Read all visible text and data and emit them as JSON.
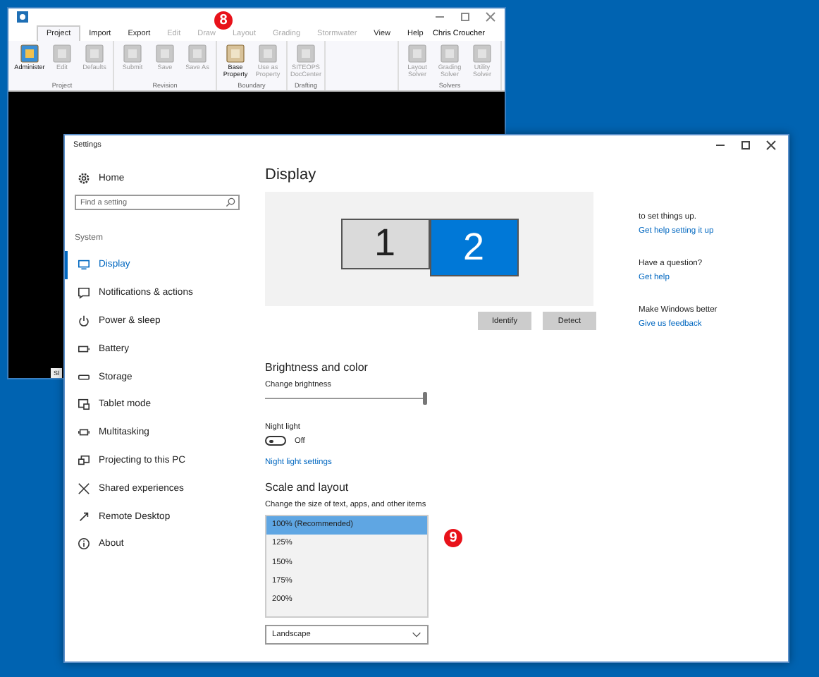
{
  "back_window": {
    "tabs": [
      {
        "label": "Project",
        "selected": true,
        "disabled": false
      },
      {
        "label": "Import",
        "selected": false,
        "disabled": false
      },
      {
        "label": "Export",
        "selected": false,
        "disabled": false
      },
      {
        "label": "Edit",
        "selected": false,
        "disabled": true
      },
      {
        "label": "Draw",
        "selected": false,
        "disabled": true
      },
      {
        "label": "Layout",
        "selected": false,
        "disabled": true
      },
      {
        "label": "Grading",
        "selected": false,
        "disabled": true
      },
      {
        "label": "Stormwater",
        "selected": false,
        "disabled": true
      },
      {
        "label": "View",
        "selected": false,
        "disabled": false
      },
      {
        "label": "Help",
        "selected": false,
        "disabled": false
      }
    ],
    "user": "Chris Croucher",
    "ribbon_groups": [
      {
        "label": "Project",
        "buttons": [
          {
            "label": "Administer",
            "disabled": false
          },
          {
            "label": "Edit",
            "disabled": true
          },
          {
            "label": "Defaults",
            "disabled": true
          }
        ]
      },
      {
        "label": "Revision",
        "buttons": [
          {
            "label": "Submit",
            "disabled": true
          },
          {
            "label": "Save",
            "disabled": true
          },
          {
            "label": "Save As",
            "disabled": true
          }
        ]
      },
      {
        "label": "Boundary",
        "buttons": [
          {
            "label": "Base Property",
            "disabled": false
          },
          {
            "label": "Use as Property",
            "disabled": true
          }
        ]
      },
      {
        "label": "Drafting",
        "buttons": [
          {
            "label": "SITEOPS DocCenter",
            "disabled": true
          }
        ]
      },
      {
        "label": "Solvers",
        "buttons": [
          {
            "label": "Layout Solver",
            "disabled": true
          },
          {
            "label": "Grading Solver",
            "disabled": true
          },
          {
            "label": "Utility Solver",
            "disabled": true
          }
        ]
      }
    ],
    "status_tab": "SI"
  },
  "settings": {
    "title": "Settings",
    "home": "Home",
    "search": {
      "placeholder": "Find a setting"
    },
    "section": "System",
    "nav_items": [
      {
        "label": "Display",
        "selected": true
      },
      {
        "label": "Notifications & actions",
        "selected": false
      },
      {
        "label": "Power & sleep",
        "selected": false
      },
      {
        "label": "Battery",
        "selected": false
      },
      {
        "label": "Storage",
        "selected": false
      },
      {
        "label": "Tablet mode",
        "selected": false
      },
      {
        "label": "Multitasking",
        "selected": false
      },
      {
        "label": "Projecting to this PC",
        "selected": false
      },
      {
        "label": "Shared experiences",
        "selected": false
      },
      {
        "label": "Remote Desktop",
        "selected": false
      },
      {
        "label": "About",
        "selected": false
      }
    ],
    "heading": "Display",
    "monitors": [
      {
        "label": "1",
        "selected": false
      },
      {
        "label": "2",
        "selected": true
      }
    ],
    "buttons": [
      "Identify",
      "Detect"
    ],
    "brightness": {
      "heading": "Brightness and color",
      "label": "Change brightness",
      "level": 1
    },
    "night_light": {
      "label": "Night light",
      "on": false,
      "state": "Off",
      "link": "Night light settings"
    },
    "scale": {
      "heading": "Scale and layout",
      "label": "Change the size of text, apps, and other items",
      "options": [
        {
          "label": "100% (Recommended)",
          "selected": true
        },
        {
          "label": "125%",
          "selected": false
        },
        {
          "label": "150%",
          "selected": false
        },
        {
          "label": "175%",
          "selected": false
        },
        {
          "label": "200%",
          "selected": false
        }
      ]
    },
    "orientation": {
      "value": "Landscape"
    },
    "help": [
      {
        "text": "to set things up.",
        "link": "Get help setting it up"
      },
      {
        "text": "Have a question?",
        "link": "Get help"
      },
      {
        "text": "Make Windows better",
        "link": "Give us feedback"
      }
    ]
  },
  "badges": [
    "8",
    "9"
  ]
}
